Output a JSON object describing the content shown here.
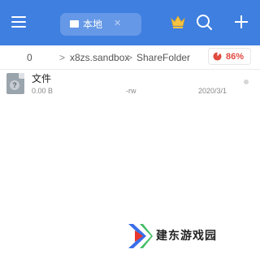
{
  "header": {
    "location_label": "本地",
    "location_close": "✕",
    "icons": [
      "menu-icon",
      "folder-icon",
      "crown-icon",
      "search-icon",
      "add-icon"
    ],
    "background": "#3f7fe0"
  },
  "breadcrumb": {
    "items": [
      "0",
      "x8zs.sandbox",
      "ShareFolder"
    ],
    "separator": ">",
    "storage_percent": "86%",
    "storage_color": "#e04a3f"
  },
  "files": [
    {
      "name": "文件",
      "size": "0.00 B",
      "permissions": "-rw",
      "date": "2020/3/1"
    }
  ],
  "watermark": {
    "text": "建东游戏园",
    "colors": [
      "#3a6ee8",
      "#e8372e",
      "#22b14c"
    ]
  }
}
